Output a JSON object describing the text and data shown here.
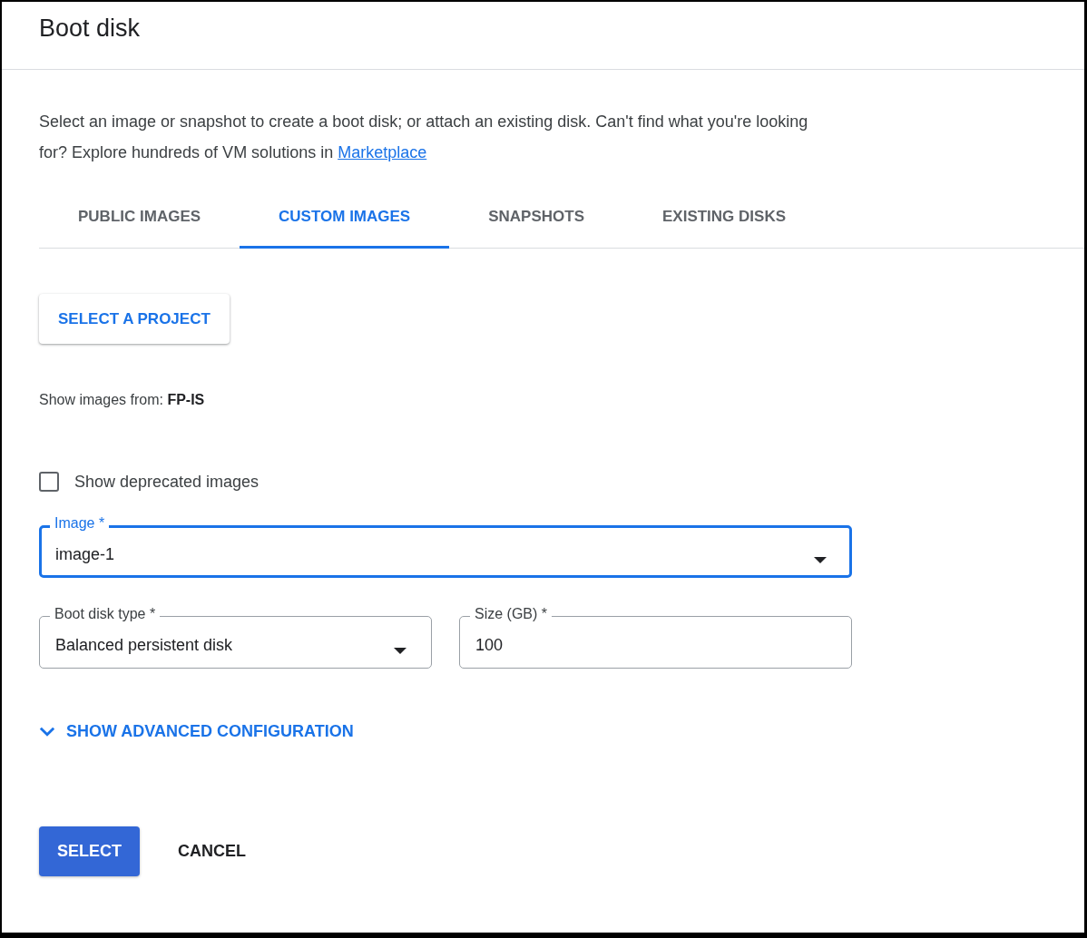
{
  "dialog": {
    "title": "Boot disk",
    "description": {
      "text": "Select an image or snapshot to create a boot disk; or attach an existing disk. Can't find what you're looking for? Explore hundreds of VM solutions in",
      "link": "Marketplace"
    },
    "tabs": [
      {
        "label": "PUBLIC IMAGES",
        "selected": false
      },
      {
        "label": "CUSTOM IMAGES",
        "selected": true
      },
      {
        "label": "SNAPSHOTS",
        "selected": false
      },
      {
        "label": "EXISTING DISKS",
        "selected": false
      }
    ],
    "select_project_button": "SELECT A PROJECT",
    "show_images_from": "Show images from: **FP-IS**",
    "deprecated_checkbox": {
      "label": "Show deprecated images",
      "checked": false
    },
    "image_field": {
      "label": "Image *",
      "value": "image-1",
      "focused": true
    },
    "boot_disk_type_field": {
      "label": "Boot disk type *",
      "value": "Balanced persistent disk",
      "focused": false
    },
    "size_field": {
      "label": "Size (GB) *",
      "value": "100",
      "focused": false
    },
    "advanced_toggle": {
      "label": "SHOW ADVANCED CONFIGURATION",
      "expanded": false
    },
    "buttons": [
      {
        "label": "SELECT",
        "kind": "primary"
      },
      {
        "label": "CANCEL",
        "kind": "text"
      }
    ]
  }
}
